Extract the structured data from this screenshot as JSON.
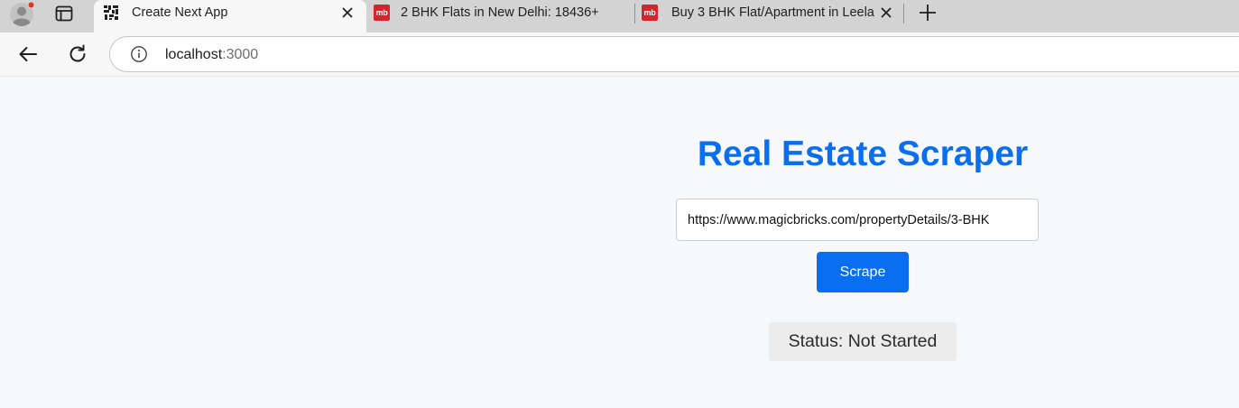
{
  "browser": {
    "tabs": [
      {
        "title": "Create Next App",
        "favicon": "nextjs-favicon-icon",
        "active": true
      },
      {
        "title": "2 BHK Flats in New Delhi: 18436+",
        "favicon": "magicbricks-favicon-icon",
        "favicon_text": "mb",
        "active": false
      },
      {
        "title": "Buy 3 BHK Flat/Apartment in Leela",
        "favicon": "magicbricks-favicon-icon",
        "favicon_text": "mb",
        "active": false
      }
    ],
    "address_bar": {
      "host": "localhost",
      "port": ":3000"
    },
    "colors": {
      "tabstrip": "#d3d3d3",
      "toolbar": "#f7f7f7",
      "favicon_mb": "#d8232a"
    }
  },
  "page": {
    "heading": "Real Estate Scraper",
    "url_input": {
      "value": "https://www.magicbricks.com/propertyDetails/3-BHK"
    },
    "scrape_button": "Scrape",
    "status": "Status: Not Started",
    "colors": {
      "accent": "#0a6ef0",
      "background": "#f7f8f9",
      "status_bg": "#ececec"
    }
  }
}
